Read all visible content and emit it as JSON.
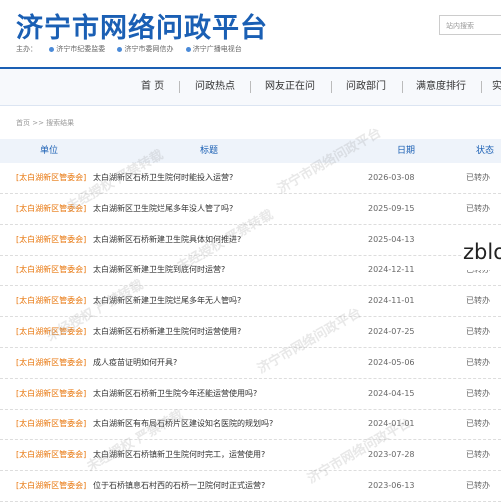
{
  "header": {
    "title": "济宁市网络问政平台",
    "links": [
      "主办：",
      "济宁市纪委监委",
      "济宁市委网信办",
      "济宁广播电视台"
    ],
    "search_placeholder": "站内搜索"
  },
  "nav": [
    "首 页",
    "问政热点",
    "网友正在问",
    "问政部门",
    "满意度排行",
    "实"
  ],
  "breadcrumb": "首页 >> 搜索结果",
  "table": {
    "columns": [
      "单位",
      "标题",
      "日期",
      "状态"
    ],
    "rows": [
      {
        "dept": "[太白湖新区管委会]",
        "title": "太白湖新区石桥卫生院何时能投入运营?",
        "date": "2026-03-08",
        "status": "已转办"
      },
      {
        "dept": "[太白湖新区管委会]",
        "title": "太白湖新区卫生院烂尾多年没人管了吗?",
        "date": "2025-09-15",
        "status": "已转办"
      },
      {
        "dept": "[太白湖新区管委会]",
        "title": "太白湖新区石桥新建卫生院具体如何推进?",
        "date": "2025-04-13",
        "status": "已转办"
      },
      {
        "dept": "[太白湖新区管委会]",
        "title": "太白湖新区新建卫生院到底何时运营?",
        "date": "2024-12-11",
        "status": "已转办"
      },
      {
        "dept": "[太白湖新区管委会]",
        "title": "太白湖新区新建卫生院烂尾多年无人管吗?",
        "date": "2024-11-01",
        "status": "已转办"
      },
      {
        "dept": "[太白湖新区管委会]",
        "title": "太白湖新区石桥新建卫生院何时运营使用?",
        "date": "2024-07-25",
        "status": "已转办"
      },
      {
        "dept": "[太白湖新区管委会]",
        "title": "成人疫苗证明如何开具?",
        "date": "2024-05-06",
        "status": "已转办"
      },
      {
        "dept": "[太白湖新区管委会]",
        "title": "太白湖新区石桥新卫生院今年还能运营使用吗?",
        "date": "2024-04-15",
        "status": "已转办"
      },
      {
        "dept": "[太白湖新区管委会]",
        "title": "太白湖新区有布局石桥片区建设知名医院的规划吗?",
        "date": "2024-01-01",
        "status": "已转办"
      },
      {
        "dept": "[太白湖新区管委会]",
        "title": "太白湖新区石桥镇新卫生院何时完工，运营使用?",
        "date": "2023-07-28",
        "status": "已转办"
      },
      {
        "dept": "[太白湖新区管委会]",
        "title": "位于石桥镇息石村西的石桥一卫院何时正式运营?",
        "date": "2023-06-13",
        "status": "已转办"
      }
    ]
  },
  "watermarks": [
    "未经授权 严禁转载",
    "济宁市网络问政平台"
  ],
  "overlay_text": "zblog",
  "colors": {
    "brand_blue": "#1a5fb4",
    "dept_orange": "#e8760c"
  }
}
